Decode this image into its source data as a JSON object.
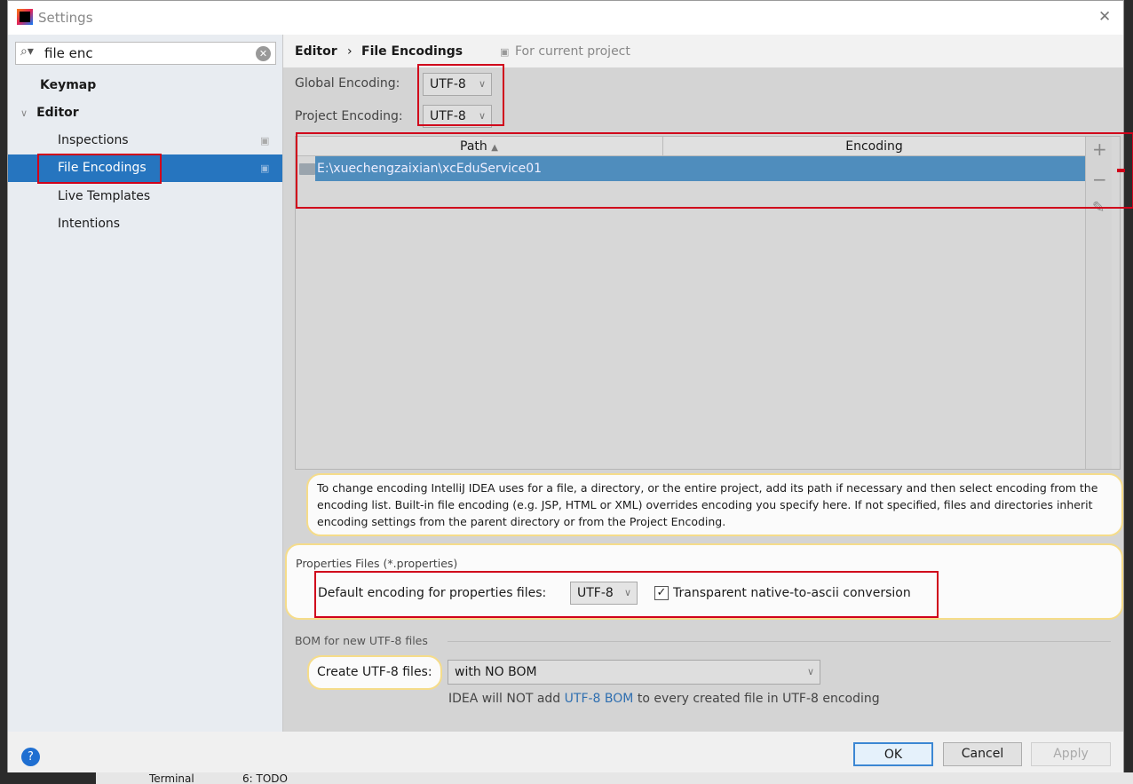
{
  "window": {
    "title": "Settings",
    "close": "✕"
  },
  "sidebar": {
    "search_value": "file enc",
    "items": [
      {
        "label": "Keymap"
      },
      {
        "label": "Editor"
      },
      {
        "label": "Inspections"
      },
      {
        "label": "File Encodings"
      },
      {
        "label": "Live Templates"
      },
      {
        "label": "Intentions"
      }
    ]
  },
  "breadcrumb": {
    "parent": "Editor",
    "separator": "›",
    "current": "File Encodings",
    "scope": "For current project"
  },
  "global_encoding": {
    "label": "Global Encoding:",
    "value": "UTF-8"
  },
  "project_encoding": {
    "label": "Project Encoding:",
    "value": "UTF-8"
  },
  "table": {
    "columns": [
      "Path",
      "Encoding"
    ],
    "rows": [
      {
        "path": "E:\\xuechengzaixian\\xcEduService01",
        "encoding": ""
      }
    ],
    "add": "+",
    "remove": "−",
    "edit": "✎"
  },
  "hint": "To change encoding IntelliJ IDEA uses for a file, a directory, or the entire project, add its path if necessary and then select encoding from the encoding list. Built-in file encoding (e.g. JSP, HTML or XML) overrides encoding you specify here. If not specified, files and directories inherit encoding settings from the parent directory or from the Project Encoding.",
  "properties": {
    "section": "Properties Files (*.properties)",
    "label": "Default encoding for properties files:",
    "value": "UTF-8",
    "checkbox_label": "Transparent native-to-ascii conversion",
    "checked": true
  },
  "bom": {
    "section": "BOM for new UTF-8 files",
    "label": "Create UTF-8 files:",
    "value": "with NO BOM",
    "note_pre": "IDEA will NOT add ",
    "note_link": "UTF-8 BOM",
    "note_post": " to every created file in UTF-8 encoding"
  },
  "footer": {
    "help": "?",
    "ok": "OK",
    "cancel": "Cancel",
    "apply": "Apply"
  },
  "taskbar": {
    "terminal": "Terminal",
    "todo": "6: TODO"
  },
  "colors": {
    "selection": "#2675bf",
    "table_selection": "#4f8dbd",
    "highlight": "#d0021b",
    "link": "#2f6fb0"
  }
}
